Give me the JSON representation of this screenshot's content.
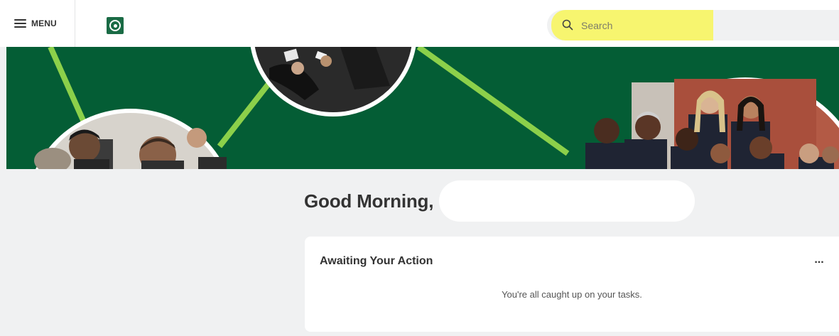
{
  "header": {
    "menu_label": "MENU",
    "logo_icon": "university-seal-icon",
    "search": {
      "placeholder": "Search",
      "icon": "search-icon"
    }
  },
  "banner": {
    "description_icons": [
      "graduates-photo",
      "students-at-computers-photo",
      "staff-group-photo"
    ],
    "colors": {
      "background": "#045d35",
      "lines": "#8cd04a"
    }
  },
  "main": {
    "greeting": "Good Morning,",
    "card": {
      "title": "Awaiting Your Action",
      "more_label": "...",
      "message": "You're all caught up on your tasks."
    }
  },
  "colors": {
    "page_bg": "#f0f1f2",
    "search_highlight": "#f7f56f",
    "brand_green": "#1a6b45"
  }
}
